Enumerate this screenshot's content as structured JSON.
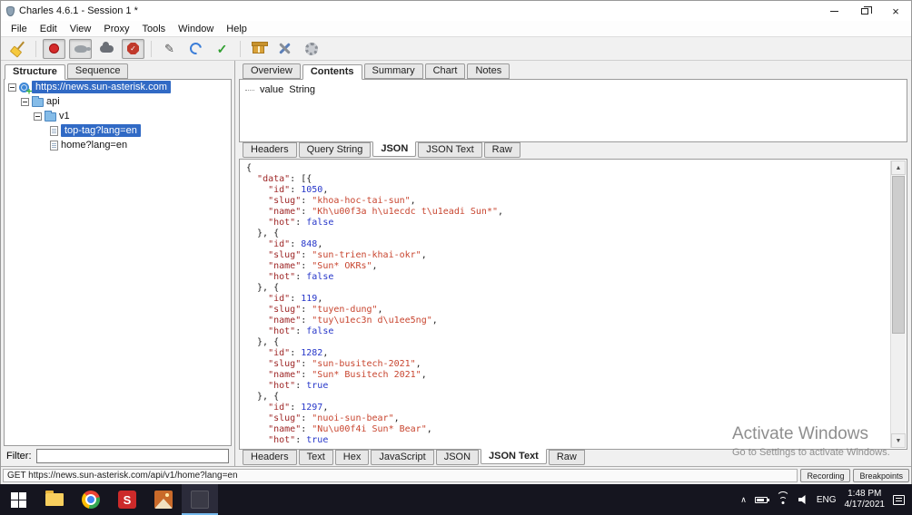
{
  "window": {
    "title": "Charles 4.6.1 - Session 1 *"
  },
  "menu_bar": {
    "items": [
      "File",
      "Edit",
      "View",
      "Proxy",
      "Tools",
      "Window",
      "Help"
    ]
  },
  "toolbar": {
    "icons": [
      "clear-session",
      "record",
      "throttle",
      "cloud",
      "breakpoints",
      "compose",
      "repeat",
      "validate",
      "gift",
      "tools",
      "settings"
    ]
  },
  "left_panel": {
    "tabs": [
      "Structure",
      "Sequence"
    ],
    "active_tab": "Structure",
    "tree": {
      "root": "https://news.sun-asterisk.com",
      "folder_api": "api",
      "folder_v1": "v1",
      "leaf_top_tag": "top-tag?lang=en",
      "leaf_home": "home?lang=en",
      "selected": "top-tag?lang=en"
    },
    "filter_label": "Filter:"
  },
  "right_panel": {
    "tabs": [
      "Overview",
      "Contents",
      "Summary",
      "Chart",
      "Notes"
    ],
    "active_tab": "Contents",
    "value_row": {
      "key": "value",
      "type": "String"
    },
    "request_tabs": [
      "Headers",
      "Query String",
      "JSON",
      "JSON Text",
      "Raw"
    ],
    "request_active_tab": "JSON",
    "response_tabs": [
      "Headers",
      "Text",
      "Hex",
      "JavaScript",
      "JSON",
      "JSON Text",
      "Raw"
    ],
    "response_active_tab": "JSON Text",
    "json_lines": [
      "{",
      "  \"data\": [{",
      "    \"id\": 1050,",
      "    \"slug\": \"khoa-hoc-tai-sun\",",
      "    \"name\": \"Kh\\u00f3a h\\u1ecdc t\\u1eadi Sun*\",",
      "    \"hot\": false",
      "  }, {",
      "    \"id\": 848,",
      "    \"slug\": \"sun-trien-khai-okr\",",
      "    \"name\": \"Sun* OKRs\",",
      "    \"hot\": false",
      "  }, {",
      "    \"id\": 119,",
      "    \"slug\": \"tuyen-dung\",",
      "    \"name\": \"tuy\\u1ec3n d\\u1ee5ng\",",
      "    \"hot\": false",
      "  }, {",
      "    \"id\": 1282,",
      "    \"slug\": \"sun-busitech-2021\",",
      "    \"name\": \"Sun* Busitech 2021\",",
      "    \"hot\": true",
      "  }, {",
      "    \"id\": 1297,",
      "    \"slug\": \"nuoi-sun-bear\",",
      "    \"name\": \"Nu\\u00f4i Sun* Bear\",",
      "    \"hot\": true"
    ]
  },
  "status_bar": {
    "url": "GET  https://news.sun-asterisk.com/api/v1/home?lang=en",
    "recording_label": "Recording",
    "breakpoints_label": "Breakpoints"
  },
  "watermark": {
    "line1": "Activate Windows",
    "line2": "Go to Settings to activate Windows."
  },
  "taskbar": {
    "language": "ENG",
    "time": "1:48 PM",
    "date": "4/17/2021"
  },
  "colors": {
    "selection_blue": "#316ac5",
    "json_key": "#9e2626",
    "json_string": "#c8452f",
    "json_literal": "#2636c9",
    "taskbar_bg": "#15151f"
  }
}
